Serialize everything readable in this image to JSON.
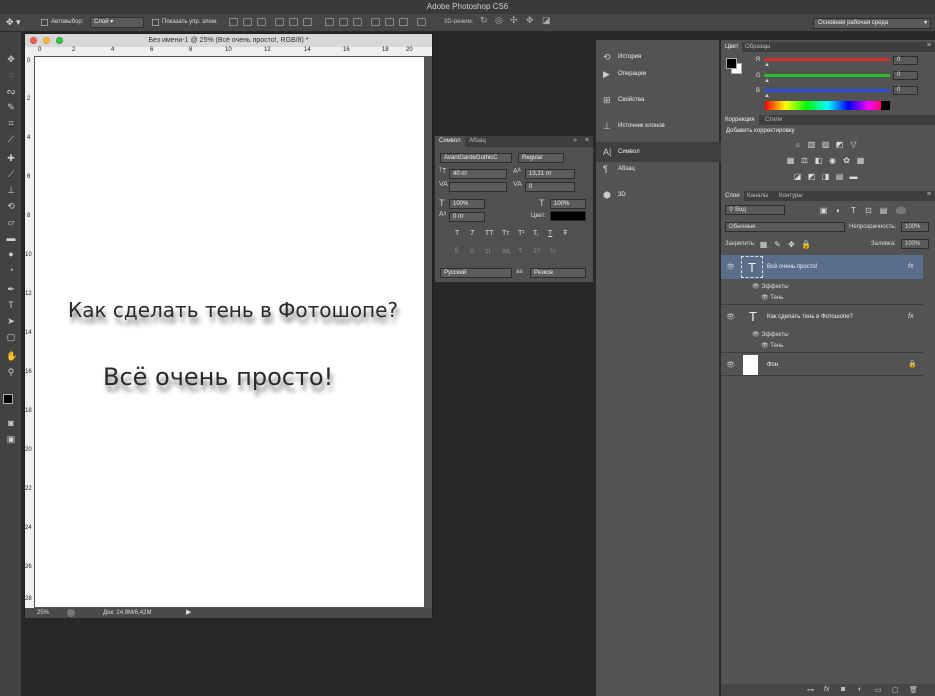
{
  "app": {
    "title": "Adobe Photoshop CS6"
  },
  "options_bar": {
    "autoselect_label": "Автовыбор:",
    "autoselect_value": "Слой",
    "show_transform_label": "Показать упр. элем.",
    "mode_3d_label": "3D-режим:",
    "workspace": "Основная рабочая среда"
  },
  "document": {
    "title": "Без имени-1 @ 25% (Всё очень просто!, RGB/8) *",
    "zoom": "25%",
    "doc_size": "Док: 24,9M/6,42M",
    "ruler_top": [
      "0",
      "2",
      "4",
      "6",
      "8",
      "10",
      "12",
      "14",
      "16",
      "18",
      "20"
    ],
    "ruler_left": [
      "0",
      "2",
      "4",
      "6",
      "8",
      "10",
      "12",
      "14",
      "16",
      "18",
      "20",
      "22",
      "24",
      "26",
      "28"
    ],
    "text_line_1": "Как сделать тень в Фотошопе?",
    "text_line_2": "Всё очень просто!"
  },
  "character_panel": {
    "tab_character": "Символ",
    "tab_paragraph": "Абзац",
    "font_family": "AvantGardeGothicC",
    "font_style": "Regular",
    "font_size": "40 пт",
    "leading": "13,21 пт",
    "tracking": "0",
    "vertical_scale": "100%",
    "horizontal_scale": "100%",
    "baseline_shift": "0 пт",
    "color_label": "Цвет:",
    "style_buttons": [
      "T",
      "T",
      "TT",
      "Tт",
      "T¹",
      "T,",
      "T",
      "Ŧ"
    ],
    "language": "Русский",
    "aa_label": "aa",
    "antialias": "Резкое"
  },
  "dock": {
    "items": [
      {
        "label": "История",
        "icon": "history-icon"
      },
      {
        "label": "Операции",
        "icon": "actions-icon"
      },
      {
        "label": "Свойства",
        "icon": "properties-icon"
      },
      {
        "label": "Источник клонов",
        "icon": "clone-source-icon"
      },
      {
        "label": "Символ",
        "icon": "character-icon"
      },
      {
        "label": "Абзац",
        "icon": "paragraph-icon"
      },
      {
        "label": "3D",
        "icon": "3d-icon"
      }
    ]
  },
  "color_panel": {
    "tab_color": "Цвет",
    "tab_swatches": "Образцы",
    "r_label": "R",
    "g_label": "G",
    "b_label": "B",
    "r_value": "0",
    "g_value": "0",
    "b_value": "0"
  },
  "adjustments_panel": {
    "tab_adjustments": "Коррекция",
    "tab_styles": "Стили",
    "add_label": "Добавить корректировку"
  },
  "layers_panel": {
    "tab_layers": "Слои",
    "tab_channels": "Каналы",
    "tab_paths": "Контуры",
    "filter_kind": "Вид",
    "blend_mode": "Обычные",
    "opacity_label": "Непрозрачность:",
    "opacity_value": "100%",
    "lock_label": "Закрепить:",
    "fill_label": "Заливка:",
    "fill_value": "100%",
    "layers": [
      {
        "name": "Всё очень просто!",
        "effects_label": "Эффекты",
        "effect": "Тень"
      },
      {
        "name": "Как сделать тень в Фотошопе?",
        "effects_label": "Эффекты",
        "effect": "Тень"
      },
      {
        "name": "Фон"
      }
    ],
    "fx_label": "fx"
  },
  "colors": {
    "accent_selected_layer": "#5a6e8c",
    "red_slider": "#d62b2b",
    "green_slider": "#2bbd2b",
    "blue_slider": "#2b4fd6"
  }
}
